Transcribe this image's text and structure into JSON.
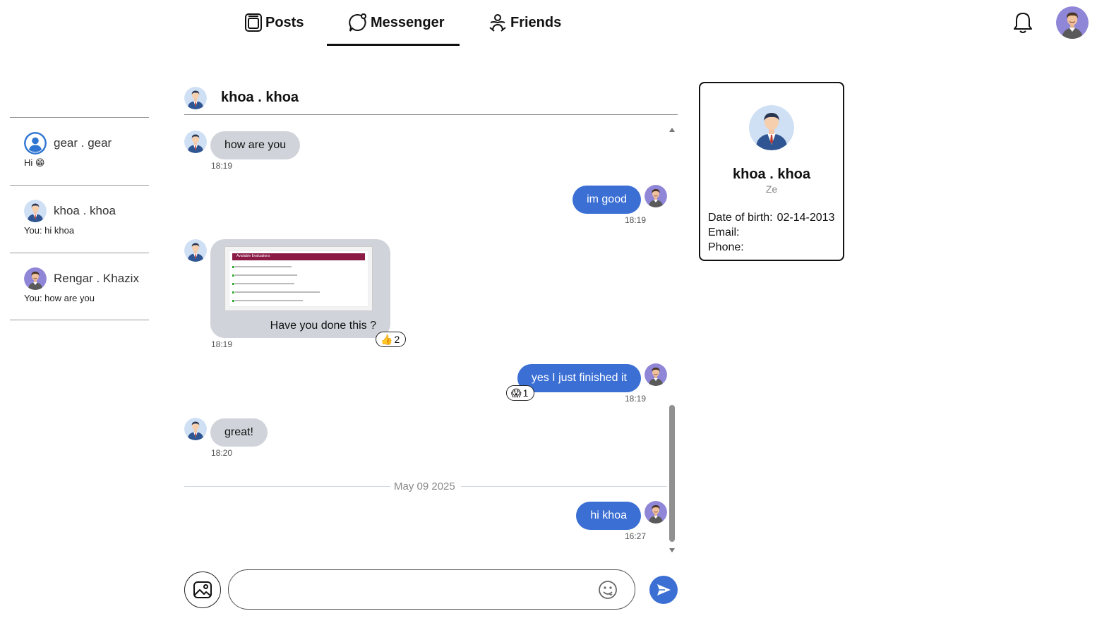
{
  "nav": {
    "tabs": [
      {
        "label": "Posts",
        "icon": "posts-icon"
      },
      {
        "label": "Messenger",
        "icon": "messenger-icon",
        "active": true
      },
      {
        "label": "Friends",
        "icon": "friends-icon"
      }
    ],
    "icons": {
      "notifications": "bell-icon",
      "profile": "user-avatar"
    }
  },
  "sidebar": {
    "conversations": [
      {
        "name": "gear . gear",
        "preview": "Hi 😁"
      },
      {
        "name": "khoa . khoa",
        "preview": "You: hi khoa"
      },
      {
        "name": "Rengar . Khazix",
        "preview": "You: how are you"
      }
    ]
  },
  "chat": {
    "title": "khoa . khoa",
    "messages": [
      {
        "direction": "in",
        "text": "how are you",
        "time": "18:19"
      },
      {
        "direction": "out",
        "text": "im good",
        "time": "18:19"
      },
      {
        "direction": "in",
        "type": "image",
        "image_header": "Available Evaluations",
        "text": "Have you done this ?",
        "time": "18:19",
        "reaction": {
          "emoji": "👍",
          "count": "2"
        }
      },
      {
        "direction": "out",
        "text": "yes I just finished it",
        "time": "18:19",
        "reaction": {
          "emoji": "😱",
          "count": "1"
        }
      },
      {
        "direction": "in",
        "text": "great!",
        "time": "18:20"
      },
      {
        "direction": "out",
        "text": "hi khoa",
        "time": "16:27"
      }
    ],
    "date_divider": "May 09 2025",
    "input": {
      "placeholder": "",
      "value": ""
    },
    "icons": {
      "image": "image-upload-icon",
      "emoji": "emoji-icon",
      "send": "send-icon"
    }
  },
  "profile": {
    "name": "khoa . khoa",
    "subtitle": "Ze",
    "fields": [
      {
        "label": "Date of birth:",
        "value": "02-14-2013"
      },
      {
        "label": "Email:",
        "value": ""
      },
      {
        "label": "Phone:",
        "value": ""
      }
    ]
  },
  "colors": {
    "outgoing_bubble": "#3b6fd4",
    "incoming_bubble": "#d0d4da",
    "accent": "#3b6fd4",
    "divider": "#cfd9e0"
  }
}
